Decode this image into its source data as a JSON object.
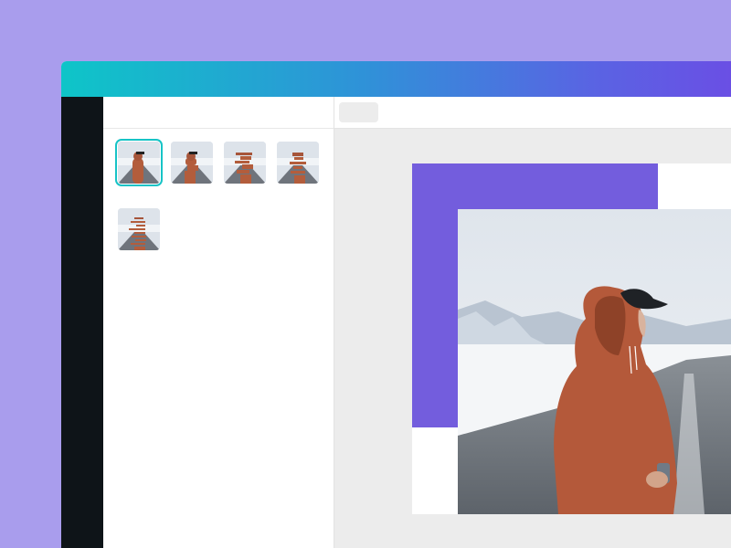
{
  "colors": {
    "background": "#a99ded",
    "titlebar_start": "#0ec5c8",
    "titlebar_end": "#6a4fe4",
    "rail": "#0e1418",
    "selection": "#17c3c6",
    "accent_block": "#735ddd",
    "workspace": "#ececec"
  },
  "panel": {
    "thumbnails": [
      {
        "variant": "original",
        "selected": true
      },
      {
        "variant": "glitch-light",
        "selected": false
      },
      {
        "variant": "glitch-medium",
        "selected": false
      },
      {
        "variant": "glitch-strong",
        "selected": false
      },
      {
        "variant": "glitch-heavy",
        "selected": false
      }
    ]
  },
  "canvas": {
    "image": "person-in-orange-hoodie-on-snowy-road"
  }
}
